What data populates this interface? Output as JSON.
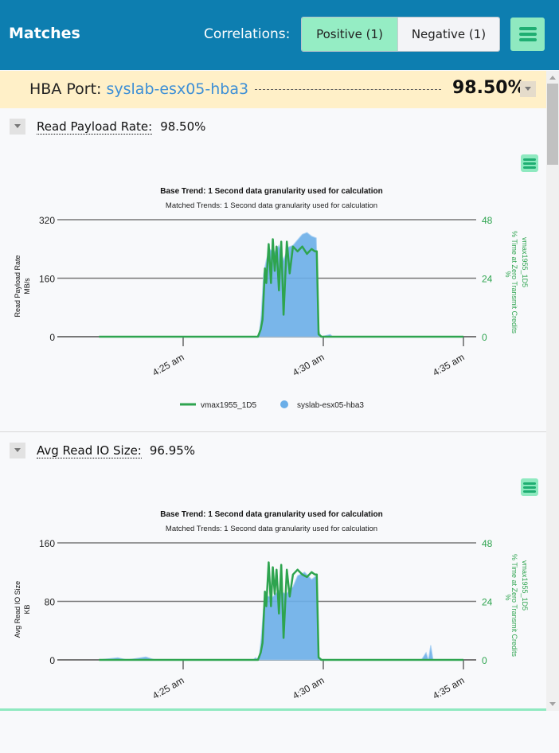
{
  "header": {
    "title": "Matches",
    "correlations_label": "Correlations:",
    "positive_label": "Positive (1)",
    "negative_label": "Negative (1)",
    "menu_icon": "hamburger-menu-icon"
  },
  "hba": {
    "label": "HBA Port:",
    "port_name": "syslab-esx05-hba3",
    "percent": "98.50%"
  },
  "colors": {
    "header": "#0d7eb0",
    "accent_green": "#2ea44f",
    "area_blue": "#6aaee8",
    "highlight": "#fff0c8"
  },
  "sections": [
    {
      "metric": "Read Payload Rate:",
      "percent": "98.50%"
    },
    {
      "metric": "Avg Read IO Size:",
      "percent": "96.95%"
    }
  ],
  "chart_data": [
    {
      "type": "line",
      "title": "Base Trend: 1 Second data granularity used for calculation",
      "subtitle": "Matched Trends: 1 Second data granularity used for calculation",
      "ylabel": "Read Payload Rate",
      "yunit": "MB/s",
      "y2label": "% Time at Zero Transmit Credits",
      "y2unit": "%",
      "y2series": "vmax1955_1D5",
      "ylim": [
        0,
        320
      ],
      "yticks": [
        "0",
        "160",
        "320"
      ],
      "y2lim": [
        0,
        48
      ],
      "y2ticks": [
        "0",
        "24",
        "48"
      ],
      "xticks": [
        "4:25 am",
        "4:30 am",
        "4:35 am"
      ],
      "grid": true,
      "legend_position": "bottom",
      "series": [
        {
          "name": "vmax1955_1D5",
          "kind": "line",
          "axis": "right",
          "color": "#2ea44f",
          "points": [
            [
              "4:22:00",
              0
            ],
            [
              "4:27:40",
              0
            ],
            [
              "4:27:46",
              3
            ],
            [
              "4:27:50",
              7
            ],
            [
              "4:27:55",
              28
            ],
            [
              "4:27:58",
              22
            ],
            [
              "4:28:03",
              38
            ],
            [
              "4:28:08",
              22
            ],
            [
              "4:28:12",
              40
            ],
            [
              "4:28:16",
              27
            ],
            [
              "4:28:20",
              37
            ],
            [
              "4:28:25",
              19
            ],
            [
              "4:28:30",
              39
            ],
            [
              "4:28:35",
              9
            ],
            [
              "4:28:42",
              39
            ],
            [
              "4:28:48",
              26
            ],
            [
              "4:28:55",
              37
            ],
            [
              "4:29:05",
              35
            ],
            [
              "4:29:15",
              37
            ],
            [
              "4:29:25",
              34
            ],
            [
              "4:29:35",
              36
            ],
            [
              "4:29:42",
              35
            ],
            [
              "4:29:46",
              35
            ],
            [
              "4:29:50",
              1
            ],
            [
              "4:29:56",
              0
            ],
            [
              "4:35:00",
              0
            ]
          ]
        },
        {
          "name": "syslab-esx05-hba3",
          "kind": "area",
          "axis": "left",
          "color": "#6aaee8",
          "points": [
            [
              "4:22:00",
              0
            ],
            [
              "4:27:42",
              0
            ],
            [
              "4:27:47",
              60
            ],
            [
              "4:27:52",
              170
            ],
            [
              "4:27:58",
              210
            ],
            [
              "4:28:05",
              240
            ],
            [
              "4:28:15",
              230
            ],
            [
              "4:28:25",
              250
            ],
            [
              "4:28:35",
              210
            ],
            [
              "4:28:45",
              245
            ],
            [
              "4:28:55",
              250
            ],
            [
              "4:29:05",
              265
            ],
            [
              "4:29:15",
              280
            ],
            [
              "4:29:25",
              285
            ],
            [
              "4:29:35",
              275
            ],
            [
              "4:29:45",
              270
            ],
            [
              "4:29:50",
              20
            ],
            [
              "4:29:55",
              0
            ],
            [
              "4:30:15",
              6
            ],
            [
              "4:30:20",
              0
            ],
            [
              "4:35:00",
              0
            ]
          ]
        }
      ]
    },
    {
      "type": "line",
      "title": "Base Trend: 1 Second data granularity used for calculation",
      "subtitle": "Matched Trends: 1 Second data granularity used for calculation",
      "ylabel": "Avg Read IO Size",
      "yunit": "KB",
      "y2label": "% Time at Zero Transmit Credits",
      "y2unit": "%",
      "y2series": "vmax1955_1D5",
      "ylim": [
        0,
        160
      ],
      "yticks": [
        "0",
        "80",
        "160"
      ],
      "y2lim": [
        0,
        48
      ],
      "y2ticks": [
        "0",
        "24",
        "48"
      ],
      "xticks": [
        "4:25 am",
        "4:30 am",
        "4:35 am"
      ],
      "grid": true,
      "series": [
        {
          "name": "vmax1955_1D5",
          "kind": "line",
          "axis": "right",
          "color": "#2ea44f",
          "points": [
            [
              "4:22:00",
              0
            ],
            [
              "4:27:40",
              0
            ],
            [
              "4:27:46",
              3
            ],
            [
              "4:27:50",
              7
            ],
            [
              "4:27:55",
              28
            ],
            [
              "4:27:58",
              22
            ],
            [
              "4:28:03",
              40
            ],
            [
              "4:28:08",
              22
            ],
            [
              "4:28:12",
              38
            ],
            [
              "4:28:16",
              27
            ],
            [
              "4:28:20",
              37
            ],
            [
              "4:28:25",
              19
            ],
            [
              "4:28:30",
              39
            ],
            [
              "4:28:35",
              9
            ],
            [
              "4:28:42",
              37
            ],
            [
              "4:28:48",
              26
            ],
            [
              "4:28:55",
              35
            ],
            [
              "4:29:05",
              37
            ],
            [
              "4:29:15",
              35
            ],
            [
              "4:29:25",
              34
            ],
            [
              "4:29:35",
              36
            ],
            [
              "4:29:42",
              35
            ],
            [
              "4:29:46",
              35
            ],
            [
              "4:29:50",
              1
            ],
            [
              "4:29:56",
              0
            ],
            [
              "4:35:00",
              0
            ]
          ]
        },
        {
          "name": "syslab-esx05-hba3",
          "kind": "area",
          "axis": "left",
          "color": "#6aaee8",
          "points": [
            [
              "4:22:00",
              0
            ],
            [
              "4:22:40",
              3
            ],
            [
              "4:23:00",
              0
            ],
            [
              "4:23:40",
              4
            ],
            [
              "4:24:00",
              0
            ],
            [
              "4:27:30",
              0
            ],
            [
              "4:27:35",
              3
            ],
            [
              "4:27:42",
              0
            ],
            [
              "4:27:47",
              30
            ],
            [
              "4:27:52",
              70
            ],
            [
              "4:27:58",
              88
            ],
            [
              "4:28:10",
              85
            ],
            [
              "4:28:25",
              95
            ],
            [
              "4:28:40",
              90
            ],
            [
              "4:28:55",
              100
            ],
            [
              "4:29:05",
              115
            ],
            [
              "4:29:20",
              120
            ],
            [
              "4:29:35",
              110
            ],
            [
              "4:29:45",
              115
            ],
            [
              "4:29:50",
              5
            ],
            [
              "4:29:55",
              0
            ],
            [
              "4:33:30",
              0
            ],
            [
              "4:33:40",
              10
            ],
            [
              "4:33:45",
              0
            ],
            [
              "4:33:50",
              20
            ],
            [
              "4:33:55",
              0
            ],
            [
              "4:35:00",
              0
            ]
          ]
        }
      ]
    }
  ]
}
